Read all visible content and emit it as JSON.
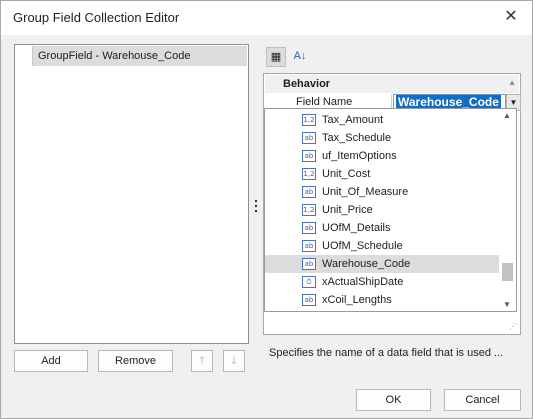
{
  "window": {
    "title": "Group Field Collection Editor",
    "close_glyph": "✕"
  },
  "left": {
    "items": [
      "GroupField - Warehouse_Code"
    ],
    "add_label": "Add",
    "remove_label": "Remove",
    "up_glyph": "🡑",
    "down_glyph": "🡓"
  },
  "toolbar": {
    "categorized_glyph": "▦",
    "alpha_glyph": "A↓"
  },
  "grid": {
    "category": "Behavior",
    "field_name_label": "Field Name",
    "field_name_value": "Warehouse_Code",
    "dropdown_glyph": "▼",
    "description": "Specifies the name of a data field that is used ..."
  },
  "popup": {
    "items": [
      {
        "label": "Tax_Amount",
        "type": "1,2"
      },
      {
        "label": "Tax_Schedule",
        "type": "ab"
      },
      {
        "label": "uf_ItemOptions",
        "type": "ab"
      },
      {
        "label": "Unit_Cost",
        "type": "1,2"
      },
      {
        "label": "Unit_Of_Measure",
        "type": "ab"
      },
      {
        "label": "Unit_Price",
        "type": "1,2"
      },
      {
        "label": "UOfM_Details",
        "type": "ab"
      },
      {
        "label": "UOfM_Schedule",
        "type": "ab"
      },
      {
        "label": "Warehouse_Code",
        "type": "ab"
      },
      {
        "label": "xActualShipDate",
        "type": "⏱"
      },
      {
        "label": "xCoil_Lengths",
        "type": "ab"
      }
    ],
    "selected_index": 8
  },
  "footer": {
    "ok_label": "OK",
    "cancel_label": "Cancel"
  }
}
